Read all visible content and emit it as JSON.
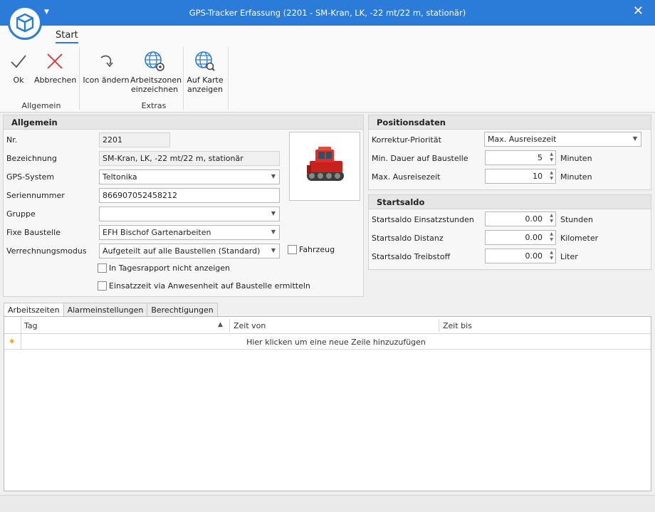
{
  "window": {
    "title": "GPS-Tracker Erfassung (2201 - SM-Kran, LK, -22 mt/22 m, stationär)",
    "close_glyph": "✕"
  },
  "ribbon": {
    "tab": "Start",
    "buttons": {
      "ok": "Ok",
      "cancel": "Abbrechen",
      "icon_change": "Icon ändern",
      "zones_line1": "Arbeitszonen",
      "zones_line2": "einzeichnen",
      "map_line1": "Auf Karte",
      "map_line2": "anzeigen"
    },
    "groups": {
      "general": "Allgemein",
      "extras": "Extras"
    }
  },
  "general": {
    "header": "Allgemein",
    "labels": {
      "nr": "Nr.",
      "bezeichnung": "Bezeichnung",
      "gps_system": "GPS-System",
      "serial": "Seriennummer",
      "gruppe": "Gruppe",
      "baustelle": "Fixe Baustelle",
      "verrechnung": "Verrechnungsmodus"
    },
    "values": {
      "nr": "2201",
      "bezeichnung": "SM-Kran, LK, -22 mt/22 m, stationär",
      "gps_system": "Teltonika",
      "serial": "866907052458212",
      "gruppe": "",
      "baustelle": "EFH Bischof Gartenarbeiten",
      "verrechnung": "Aufgeteilt auf alle Baustellen (Standard)"
    },
    "checkboxes": {
      "fahrzeug": "Fahrzeug",
      "tagesrapport": "In Tagesrapport nicht anzeigen",
      "anwesenheit": "Einsatzzeit via Anwesenheit auf Baustelle ermitteln"
    }
  },
  "position": {
    "header": "Positionsdaten",
    "labels": {
      "prio": "Korrektur-Priorität",
      "min": "Min. Dauer auf Baustelle",
      "max": "Max. Ausreisezeit"
    },
    "values": {
      "prio": "Max. Ausreisezeit",
      "min": "5",
      "max": "10"
    },
    "unit": "Minuten"
  },
  "startsaldo": {
    "header": "Startsaldo",
    "labels": {
      "stunden": "Startsaldo Einsatzstunden",
      "distanz": "Startsaldo Distanz",
      "treibstoff": "Startsaldo Treibstoff"
    },
    "values": {
      "stunden": "0.00",
      "distanz": "0.00",
      "treibstoff": "0.00"
    },
    "units": {
      "stunden": "Stunden",
      "distanz": "Kilometer",
      "treibstoff": "Liter"
    }
  },
  "tabs": [
    "Arbeitszeiten",
    "Alarmeinstellungen",
    "Berechtigungen"
  ],
  "grid": {
    "columns": [
      "Tag",
      "Zeit von",
      "Zeit bis"
    ],
    "new_row_hint": "Hier klicken um eine neue Zeile hinzuzufügen"
  },
  "colors": {
    "accent": "#2b7bd8",
    "cancel_red": "#e0312e"
  }
}
